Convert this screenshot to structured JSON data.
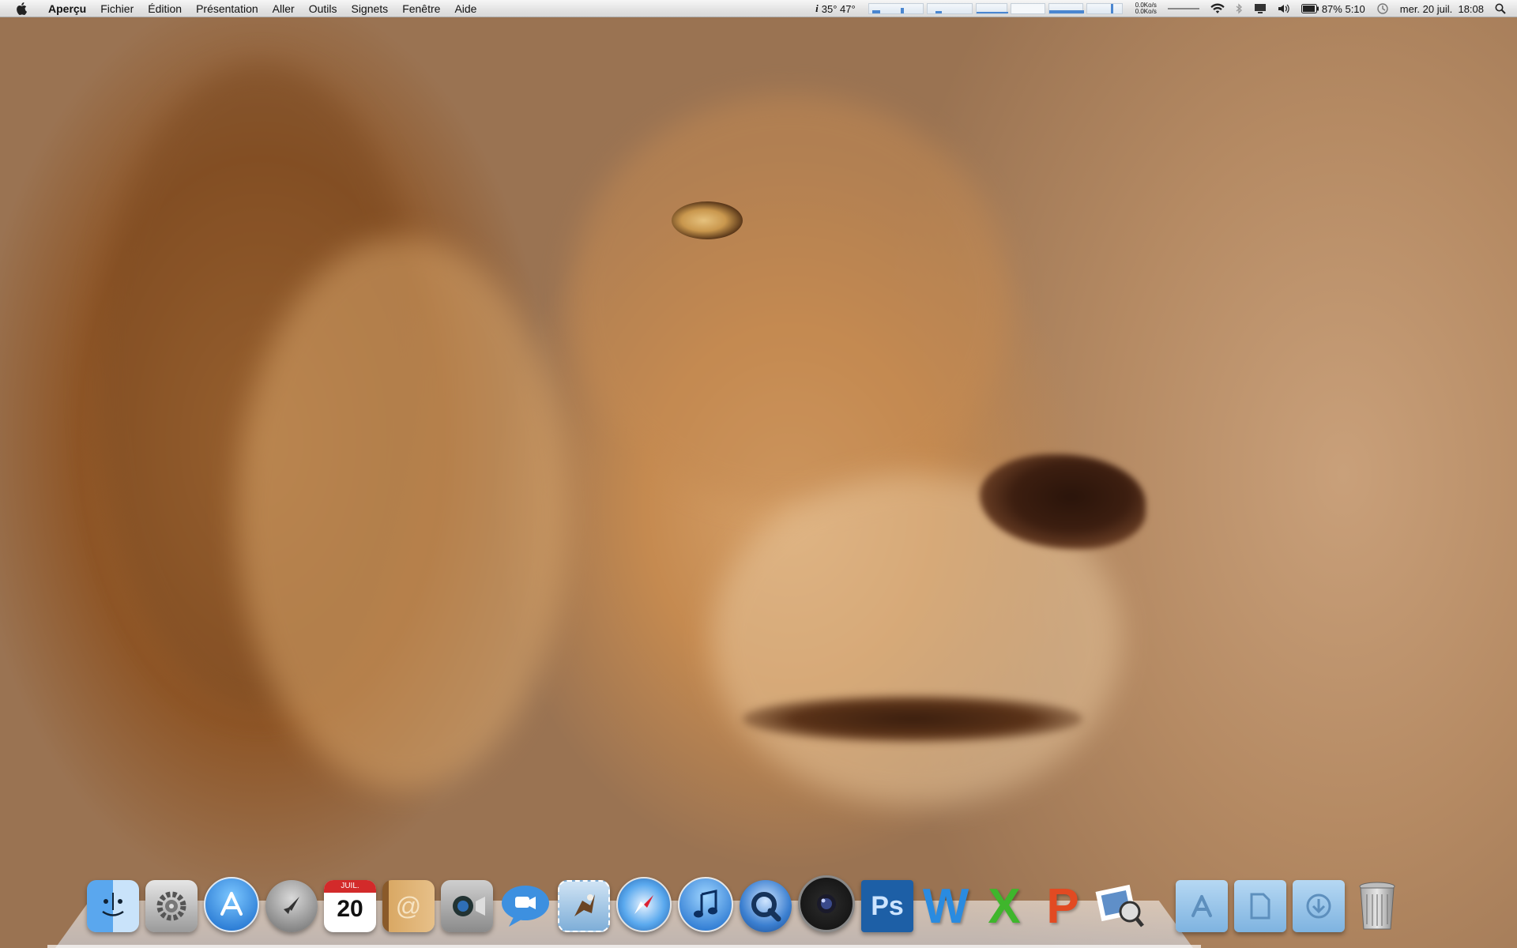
{
  "menubar": {
    "app_name": "Aperçu",
    "items": [
      "Fichier",
      "Édition",
      "Présentation",
      "Aller",
      "Outils",
      "Signets",
      "Fenêtre",
      "Aide"
    ],
    "status": {
      "temperature": "35° 47°",
      "net_up": "0.0Ko/s",
      "net_down": "0.0Ko/s",
      "battery": "87% 5:10",
      "datetime": "mer. 20 juil.  18:08"
    }
  },
  "dock": {
    "calendar_month": "JUIL.",
    "calendar_day": "20",
    "photoshop_label": "Ps",
    "word_label": "W",
    "excel_label": "X",
    "powerpoint_label": "P"
  },
  "colors": {
    "menubar_bg": "#e8e8e8",
    "dock_folder": "#8fc0e8",
    "photoshop": "#1d5fa6"
  }
}
